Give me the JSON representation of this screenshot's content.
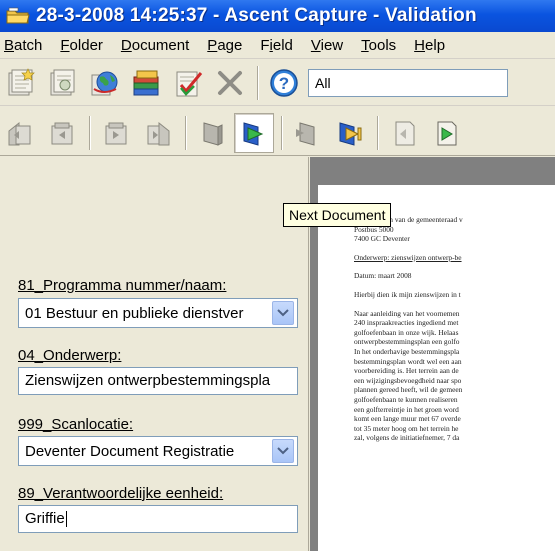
{
  "window": {
    "title": "28-3-2008 14:25:37 - Ascent Capture - Validation"
  },
  "menu": [
    {
      "label": "Batch",
      "accel": "B",
      "rest": "atch"
    },
    {
      "label": "Folder",
      "accel": "F",
      "rest": "older"
    },
    {
      "label": "Document",
      "accel": "D",
      "rest": "ocument"
    },
    {
      "label": "Page",
      "accel": "P",
      "rest": "age"
    },
    {
      "label": "Field",
      "accel": "i",
      "pre": "F",
      "rest": "eld"
    },
    {
      "label": "View",
      "accel": "V",
      "rest": "iew"
    },
    {
      "label": "Tools",
      "accel": "T",
      "rest": "ools"
    },
    {
      "label": "Help",
      "accel": "H",
      "rest": "elp"
    }
  ],
  "toolbar": {
    "filter_value": "All",
    "icons_row1": [
      "new-batch-icon",
      "open-batch-icon",
      "globe-icon",
      "batch-list-icon",
      "validate-checkmark-icon",
      "delete-x-icon",
      "help-icon"
    ],
    "icons_row2": [
      "first-folder-icon",
      "previous-folder-icon",
      "next-folder-icon",
      "last-folder-icon",
      "previous-document-icon",
      "next-document-icon",
      "first-document-icon",
      "last-document-icon",
      "previous-page-icon",
      "next-page-icon"
    ]
  },
  "tooltip": "Next Document",
  "fields": [
    {
      "label": "81_Programma nummer/naam:",
      "value": "01 Bestuur en publieke dienstver",
      "type": "combo"
    },
    {
      "label": "04_Onderwerp:",
      "value": "Zienswijzen ontwerpbestemmingspla",
      "type": "text"
    },
    {
      "label": "999_Scanlocatie:",
      "value": "Deventer Document Registratie",
      "type": "combo"
    },
    {
      "label": "89_Verantwoordelijke eenheid:",
      "value": "Griffie",
      "type": "text"
    }
  ],
  "document": {
    "lines": [
      "Aan de leden van de gemeenteraad v",
      "Postbus 5000",
      "7400 GC  Deventer",
      "",
      "Onderwerp: zienswijzen ontwerp-be",
      "",
      "Datum: maart 2008",
      "",
      "Hierbij dien ik mijn zienswijzen in t",
      "",
      "Naar aanleiding van het voornemen",
      "240 inspraakreacties ingediend met",
      "golfoefenbaan in onze wijk. Helaas",
      "ontwerpbestemmingsplan een golfo",
      "In het onderhavige bestemmingspla",
      "bestemmingsplan wordt wel een aan",
      "voorbereiding is. Het terrein aan de",
      "een wijzigingsbevoegdheid naar spo",
      "plannen gereed heeft, wil de gemeen",
      "golfoefenbaan te kunnen realiseren",
      "een golfterreintje in het groen word",
      "komt een lange muur met 67 overde",
      "tot 35 meter hoog om het terrein he",
      "zal, volgens de initiatiefnemer, 7 da"
    ]
  },
  "colors": {
    "titlebar": "#0a54e0",
    "window_bg": "#ece9d8",
    "tooltip_bg": "#ffffe1",
    "field_border": "#7f9db9"
  }
}
